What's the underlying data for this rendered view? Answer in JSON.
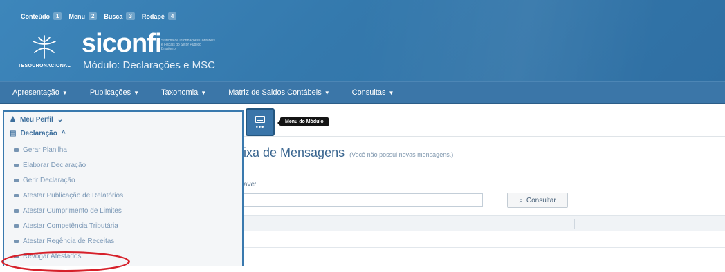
{
  "header": {
    "skip_links": [
      {
        "label": "Conteúdo",
        "key": "1"
      },
      {
        "label": "Menu",
        "key": "2"
      },
      {
        "label": "Busca",
        "key": "3"
      },
      {
        "label": "Rodapé",
        "key": "4"
      }
    ],
    "agency": "TESOURONACIONAL",
    "brand": "siconfi",
    "brand_description": "Sistema de Informações Contábeis e Fiscais do Setor Público Brasileiro",
    "module": "Módulo: Declarações e MSC",
    "background_color": "#3479ad"
  },
  "nav": {
    "items": [
      {
        "label": "Apresentação",
        "dropdown": true
      },
      {
        "label": "Publicações",
        "dropdown": true
      },
      {
        "label": "Taxonomia",
        "dropdown": true
      },
      {
        "label": "Matriz de Saldos Contábeis",
        "dropdown": true
      },
      {
        "label": "Consultas",
        "dropdown": true
      }
    ]
  },
  "sidebar": {
    "profile": "Meu Perfil",
    "section": "Declaração",
    "items": [
      {
        "label": "Gerar Planilha"
      },
      {
        "label": "Elaborar Declaração"
      },
      {
        "label": "Gerir Declaração"
      },
      {
        "label": "Atestar Publicação de Relatórios"
      },
      {
        "label": "Atestar Cumprimento de Limites"
      },
      {
        "label": "Atestar Competência Tributária"
      },
      {
        "label": "Atestar Regência de Receitas"
      },
      {
        "label": "Revogar Atestados"
      }
    ],
    "highlighted_item": "Revogar Atestados",
    "highlight_color": "#d6202a"
  },
  "main": {
    "module_menu_tooltip": "Menu do Módulo",
    "inbox_title": "ixa de Mensagens",
    "inbox_note": "(Você não possui novas mensagens.)",
    "key_label": "ave:",
    "key_value": "",
    "consult_button": "Consultar"
  }
}
